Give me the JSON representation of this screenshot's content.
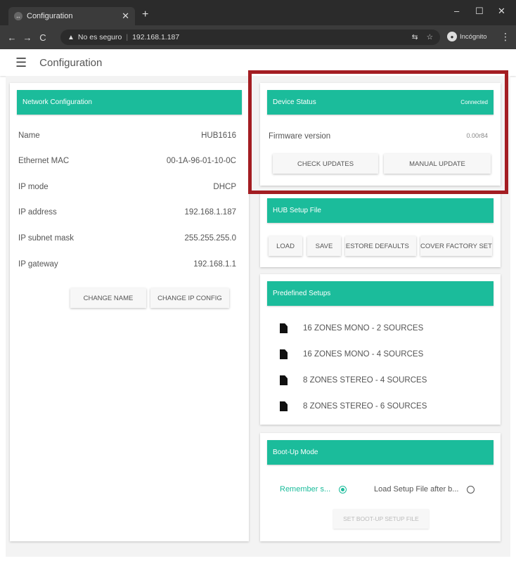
{
  "browser": {
    "tab_title": "Configuration",
    "url_security": "No es seguro",
    "url": "192.168.1.187",
    "incognito_label": "Incógnito"
  },
  "app": {
    "title": "Configuration"
  },
  "network": {
    "header": "Network Configuration",
    "rows": [
      {
        "label": "Name",
        "value": "HUB1616"
      },
      {
        "label": "Ethernet MAC",
        "value": "00-1A-96-01-10-0C"
      },
      {
        "label": "IP mode",
        "value": "DHCP"
      },
      {
        "label": "IP address",
        "value": "192.168.1.187"
      },
      {
        "label": "IP subnet mask",
        "value": "255.255.255.0"
      },
      {
        "label": "IP gateway",
        "value": "192.168.1.1"
      }
    ],
    "change_name": "CHANGE NAME",
    "change_ip": "CHANGE IP CONFIG"
  },
  "device_status": {
    "header": "Device Status",
    "status": "Connected",
    "firmware_label": "Firmware version",
    "firmware_value": "0.00r84",
    "check_updates": "CHECK UPDATES",
    "manual_update": "MANUAL UPDATE"
  },
  "setup_file": {
    "header": "HUB Setup File",
    "load": "LOAD",
    "save": "SAVE",
    "restore_defaults": "RESTORE DEFAULTS",
    "recover_factory": "RECOVER FACTORY SETUP"
  },
  "predefined": {
    "header": "Predefined Setups",
    "items": [
      "16 ZONES MONO - 2 SOURCES",
      "16 ZONES MONO - 4 SOURCES",
      "8 ZONES STEREO - 4 SOURCES",
      "8 ZONES STEREO - 6 SOURCES"
    ]
  },
  "bootup": {
    "header": "Boot-Up Mode",
    "option1": "Remember s...",
    "option2": "Load Setup File after b...",
    "set_button": "SET BOOT-UP SETUP FILE"
  },
  "colors": {
    "accent": "#1bbc9b",
    "highlight": "#a31d22"
  }
}
